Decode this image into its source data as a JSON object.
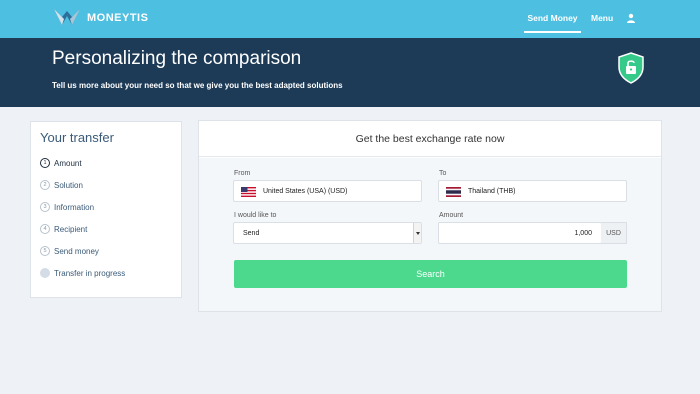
{
  "nav": {
    "brand": "MONEYTIS",
    "send_money": "Send Money",
    "menu": "Menu",
    "user_icon": "user-icon"
  },
  "hero": {
    "title": "Personalizing the comparison",
    "subtitle": "Tell us more about your need so that we give you the best adapted solutions",
    "shield_icon": "shield-lock-icon"
  },
  "steps": {
    "title": "Your transfer",
    "items": [
      {
        "num": "1",
        "label": "Amount",
        "active": true
      },
      {
        "num": "2",
        "label": "Solution"
      },
      {
        "num": "3",
        "label": "Information"
      },
      {
        "num": "4",
        "label": "Recipient"
      },
      {
        "num": "5",
        "label": "Send money"
      },
      {
        "num": "",
        "label": "Transfer in progress"
      }
    ]
  },
  "form": {
    "title": "Get the best exchange rate now",
    "from_label": "From",
    "from_value": "United States (USA) (USD)",
    "to_label": "To",
    "to_value": "Thailand (THB)",
    "action_label": "I would like to",
    "action_value": "Send",
    "amount_label": "Amount",
    "amount_value": "1,000",
    "currency": "USD",
    "search": "Search"
  },
  "colors": {
    "nav": "#4dbfe0",
    "hero": "#1d3a57",
    "button": "#4cd98e",
    "shield": "#35c98a"
  }
}
